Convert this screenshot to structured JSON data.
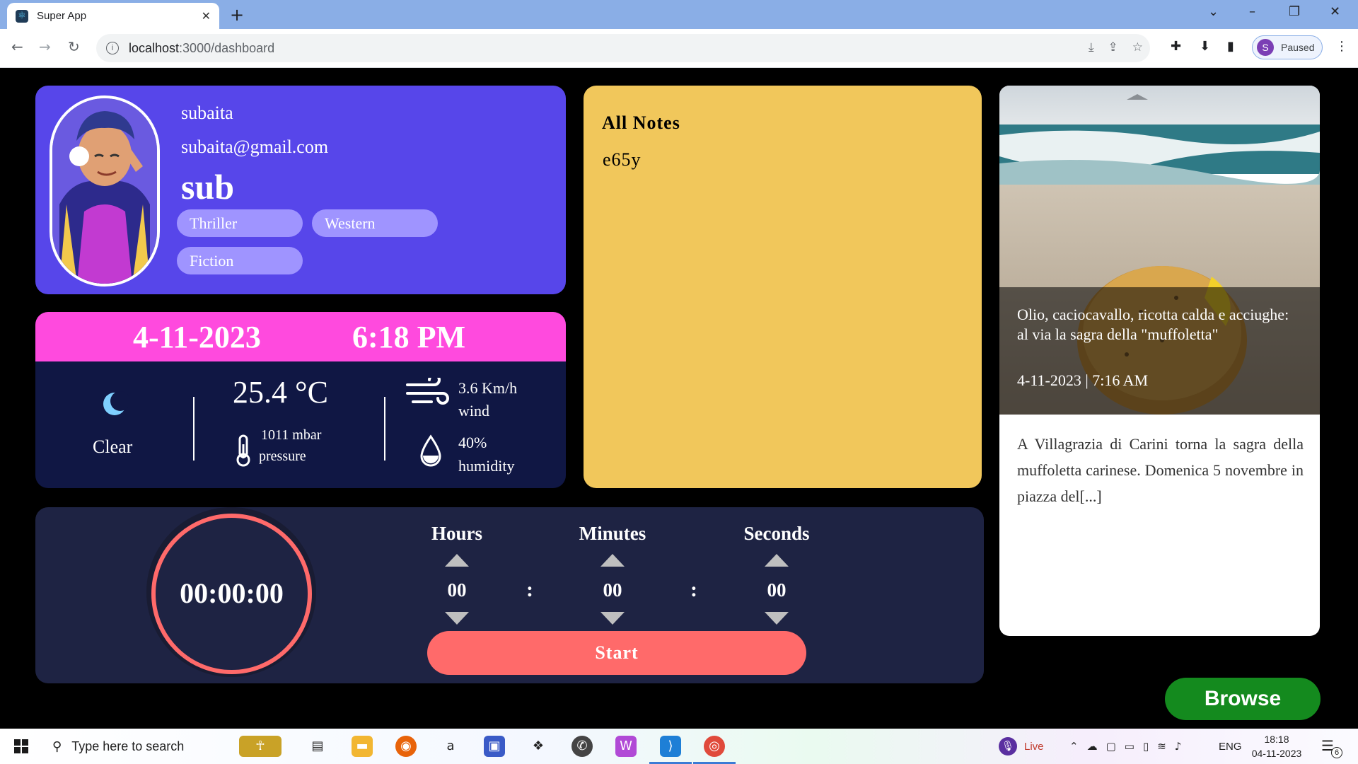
{
  "browser": {
    "tab_title": "Super App",
    "url_host": "localhost",
    "url_rest": ":3000/dashboard",
    "profile_initial": "S",
    "profile_status": "Paused"
  },
  "user": {
    "name": "subaita",
    "email": "subaita@gmail.com",
    "username": "sub",
    "genres": [
      "Thriller",
      "Western",
      "Fiction"
    ]
  },
  "datetime": {
    "date": "4-11-2023",
    "time": "6:18 PM"
  },
  "weather": {
    "condition": "Clear",
    "temperature": "25.4 °C",
    "pressure_value": "1011 mbar",
    "pressure_label": "pressure",
    "wind_value": "3.6 Km/h",
    "wind_label": "wind",
    "humidity_value": "40%",
    "humidity_label": "humidity"
  },
  "notes": {
    "title": "All Notes",
    "content": "e65y"
  },
  "news": {
    "title": "Olio, caciocavallo, ricotta calda e acciughe: al via la sagra della \"muffoletta\"",
    "date": "4-11-2023 | 7:16 AM",
    "description": "A Villagrazia di Carini torna la sagra della muffoletta carinese. Domenica 5 novembre in piazza del[...]"
  },
  "timer": {
    "display": "00:00:00",
    "hours_label": "Hours",
    "minutes_label": "Minutes",
    "seconds_label": "Seconds",
    "hours": "00",
    "minutes": "00",
    "seconds": "00",
    "colon": ":",
    "start_label": "Start"
  },
  "browse_label": "Browse",
  "taskbar": {
    "search_placeholder": "Type here to search",
    "live_label": "Live",
    "language": "ENG",
    "time": "18:18",
    "date": "04-11-2023",
    "notification_count": "6"
  },
  "colors": {
    "user_card": "#5746ea",
    "chip": "#9f94ff",
    "date_bar": "#ff4ade",
    "weather_bg": "#101744",
    "notes_bg": "#f1c75b",
    "timer_bg": "#1e2343",
    "timer_accent": "#ff6a6a",
    "browse_bg": "#148a1e"
  }
}
